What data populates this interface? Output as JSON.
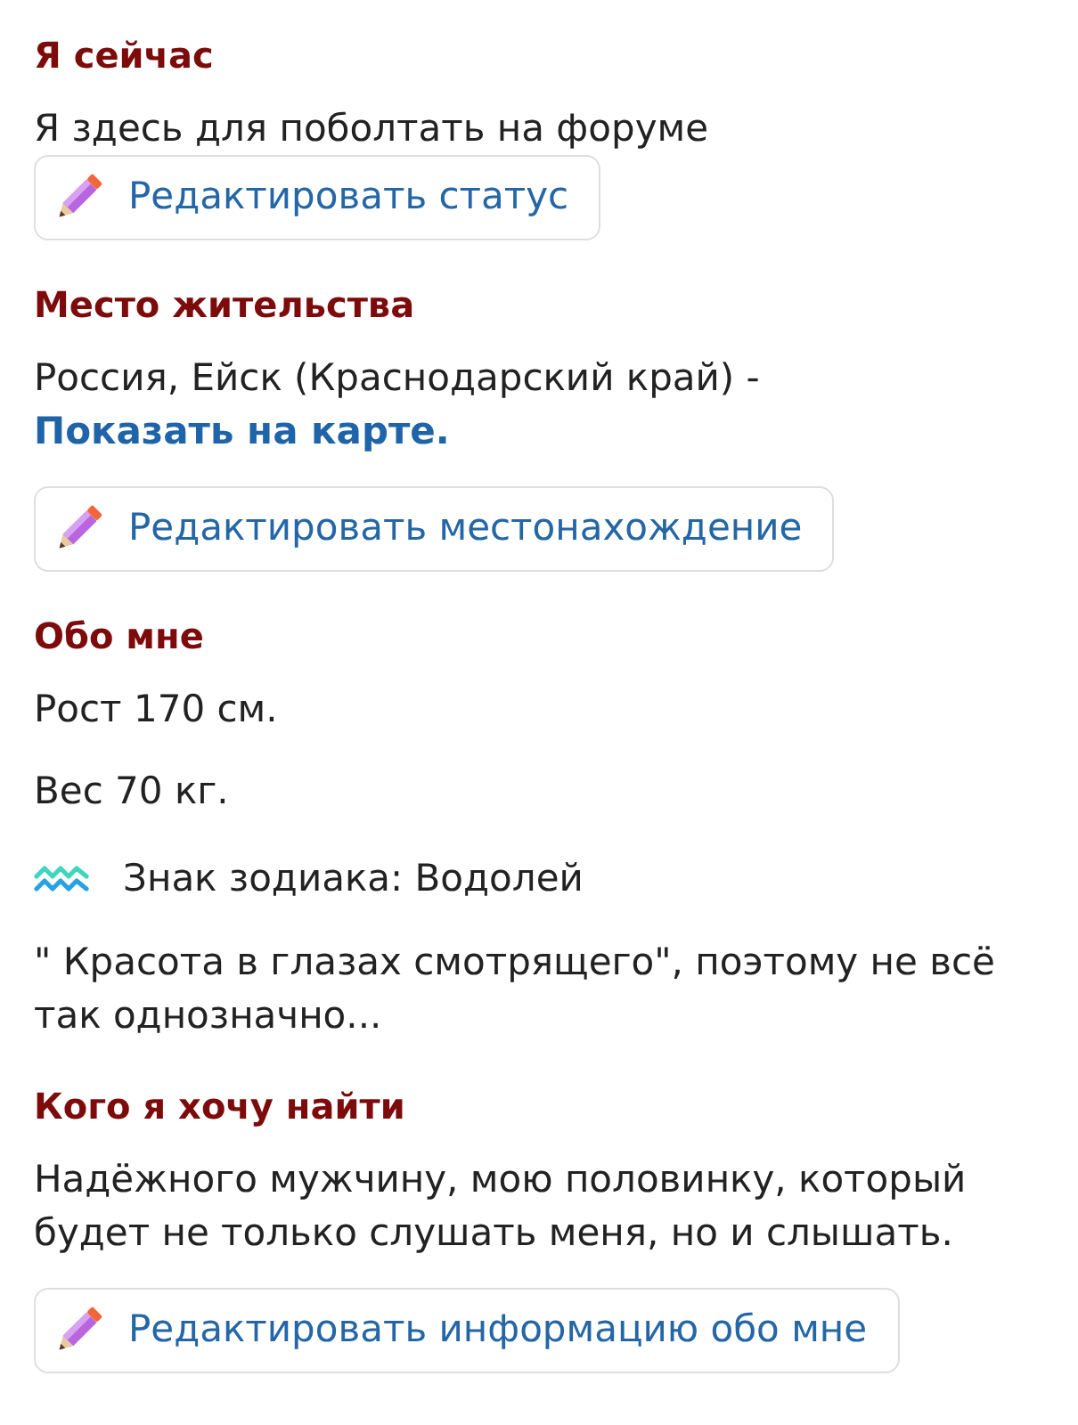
{
  "sections": [
    {
      "heading": "Я сейчас",
      "paragraphs": [
        {
          "kind": "status",
          "text": "Я здесь для поболтать на форуме"
        }
      ],
      "edit_button": {
        "label": "Редактировать статус"
      }
    },
    {
      "heading": "Место жительства",
      "paragraphs": [
        {
          "kind": "location",
          "text": "Россия, Ейск (Краснодарский край) -",
          "link": "Показать на карте."
        }
      ],
      "edit_button": {
        "label": "Редактировать местонахождение"
      }
    },
    {
      "heading": "Обо мне",
      "paragraphs": [
        {
          "kind": "text",
          "text": "Рост 170 см."
        },
        {
          "kind": "text",
          "text": "Вес 70 кг."
        },
        {
          "kind": "zodiac",
          "text": "Знак зодиака: Водолей"
        },
        {
          "kind": "text",
          "text": "\" Красота в глазах смотрящего\", поэтому не всё так однозначно..."
        }
      ]
    },
    {
      "heading": "Кого я хочу найти",
      "paragraphs": [
        {
          "kind": "text",
          "text": "Надёжного мужчину, мою половинку, который будет не только слушать меня, но и слышать."
        }
      ],
      "edit_button": {
        "label": "Редактировать информацию обо мне"
      }
    }
  ]
}
